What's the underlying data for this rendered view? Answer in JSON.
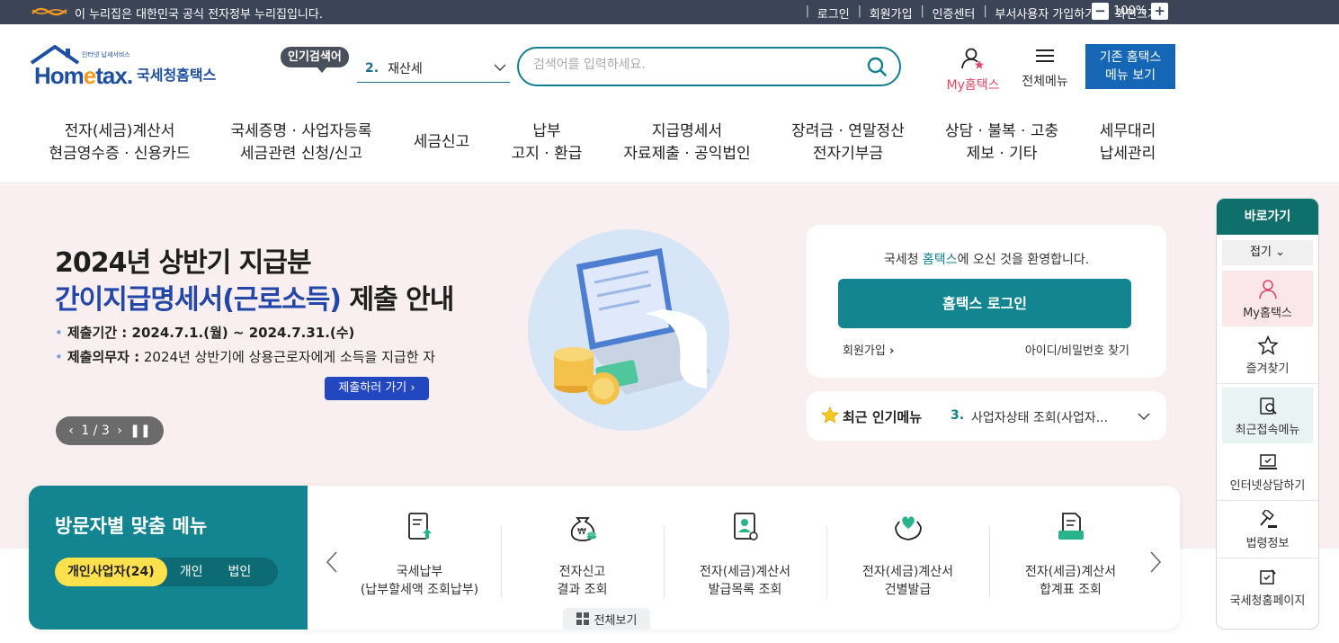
{
  "govbar": {
    "notice": "이 누리집은 대한민국 공식 전자정부 누리집입니다.",
    "links": [
      "로그인",
      "회원가입",
      "인증센터",
      "부서사용자 가입하기",
      "화면크기"
    ],
    "zoom_minus": "−",
    "zoom_value": "100%",
    "zoom_plus": "+"
  },
  "header": {
    "logo_sub": "인터넷 납세서비스",
    "logo_en_pre": "Hom",
    "logo_en_e": "e",
    "logo_en_post": "tax.",
    "logo_kr": "국세청홈택스",
    "popular_badge": "인기검색어",
    "popular_num": "2.",
    "popular_term": "재산세",
    "search_placeholder": "검색어를 입력하세요.",
    "my_label": "My홈택스",
    "allmenu_label": "전체메뉴",
    "legacy_line1": "기존 홈택스",
    "legacy_line2": "메뉴 보기"
  },
  "gnb": [
    {
      "l1": "전자(세금)계산서",
      "l2": "현금영수증 · 신용카드"
    },
    {
      "l1": "국세증명 · 사업자등록",
      "l2": "세금관련 신청/신고"
    },
    {
      "l1": "세금신고",
      "l2": ""
    },
    {
      "l1": "납부",
      "l2": "고지 · 환급"
    },
    {
      "l1": "지급명세서",
      "l2": "자료제출 · 공익법인"
    },
    {
      "l1": "장려금 · 연말정산",
      "l2": "전자기부금"
    },
    {
      "l1": "상담 · 불복 · 고충",
      "l2": "제보 · 기타"
    },
    {
      "l1": "세무대리",
      "l2": "납세관리"
    }
  ],
  "hero": {
    "title1": "2024년 상반기 지급분",
    "title2_hl": "간이지급명세서(근로소득)",
    "title2_rest": " 제출 안내",
    "b1_label": "제출기간 :",
    "b1_value": " 2024.7.1.(월) ~ 2024.7.31.(수)",
    "b2_label": "제출의무자 :",
    "b2_value": " 2024년 상반기에 상용근로자에게 소득을 지급한 자",
    "cta": "제출하러 가기",
    "pager": "1 / 3"
  },
  "login": {
    "welcome_pre": "국세청 ",
    "welcome_key": "홈택스",
    "welcome_post": "에 오신 것을 환영합니다.",
    "button": "홈택스 로그인",
    "join": "회원가입",
    "find": "아이디/비밀번호 찾기"
  },
  "hotmenu": {
    "title": "최근 인기메뉴",
    "num": "3.",
    "value": "사업자상태 조회(사업자..."
  },
  "visitor": {
    "title": "방문자별 맞춤 메뉴",
    "tabs": [
      "개인사업자(24)",
      "개인",
      "법인"
    ],
    "items": [
      {
        "l1": "국세납부",
        "l2": "(납부할세액 조회납부)"
      },
      {
        "l1": "전자신고",
        "l2": "결과 조회"
      },
      {
        "l1": "전자(세금)계산서",
        "l2": "발급목록 조회"
      },
      {
        "l1": "전자(세금)계산서",
        "l2": "건별발급"
      },
      {
        "l1": "전자(세금)계산서",
        "l2": "합계표 조회"
      }
    ],
    "view_all": "전체보기"
  },
  "quick": {
    "title": "바로가기",
    "fold": "접기",
    "items": [
      "My홈택스",
      "즐겨찾기",
      "최근접속메뉴",
      "인터넷상담하기",
      "법령정보",
      "국세청홈페이지"
    ]
  },
  "colors": {
    "teal": "#128590",
    "navy": "#3b4557",
    "blue": "#1567b6",
    "hero_bg": "#f9eef0",
    "pink": "#e04768"
  }
}
